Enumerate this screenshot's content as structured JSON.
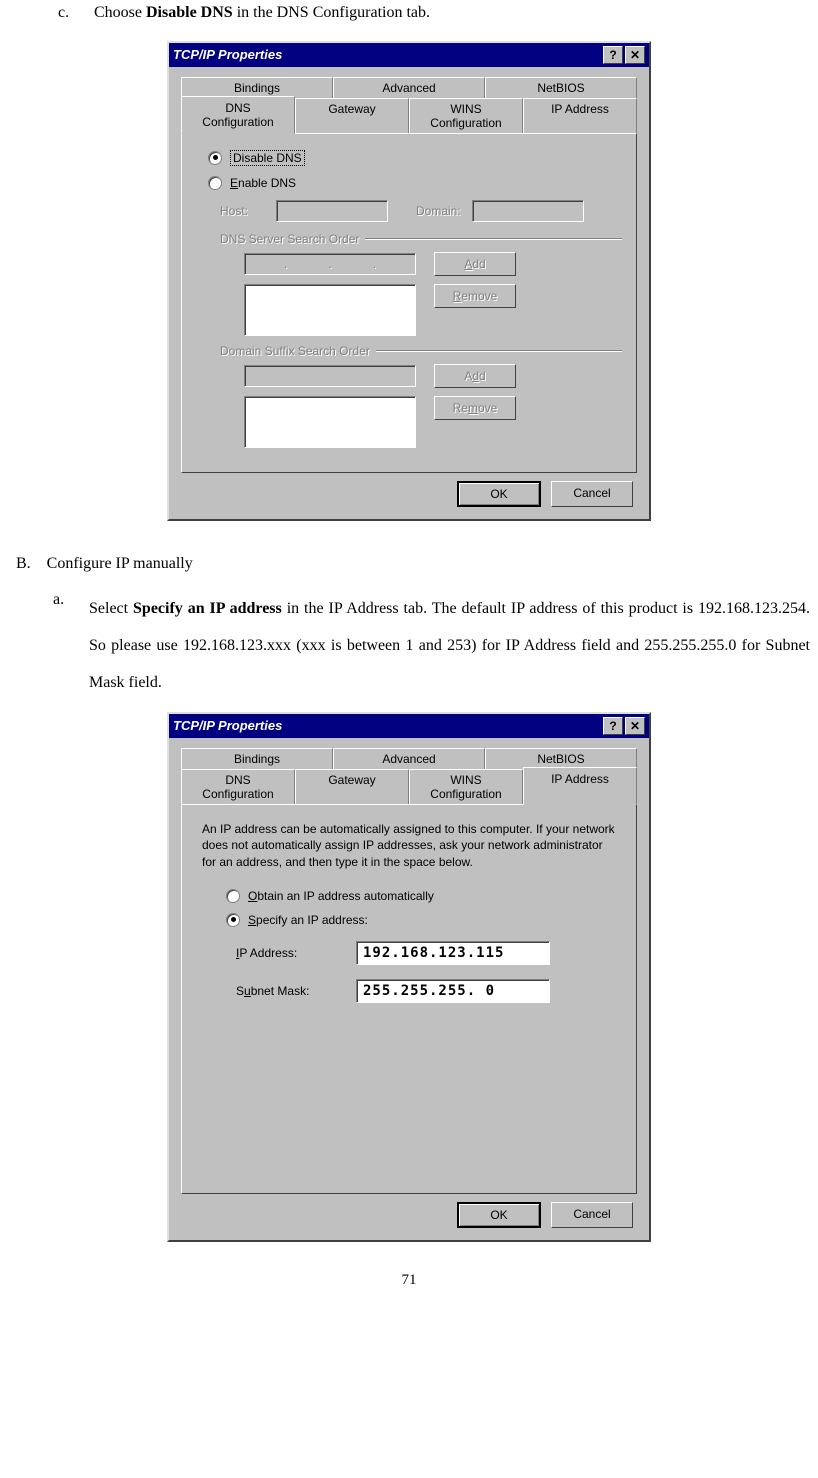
{
  "doc": {
    "step_c_marker": "c.",
    "step_c_prefix": "Choose ",
    "step_c_bold": "Disable DNS",
    "step_c_suffix": " in the DNS Configuration tab.",
    "section_b_marker": "B.",
    "section_b_text": "Configure IP manually",
    "step_a_marker": "a.",
    "step_a_prefix": "Select ",
    "step_a_bold": "Specify an IP address",
    "step_a_suffix": " in the IP Address tab. The default IP address of this product is 192.168.123.254. So please use 192.168.123.xxx (xxx is between 1 and 253) for IP Address field and 255.255.255.0 for Subnet Mask field.",
    "page_number": "71"
  },
  "dialog1": {
    "title": "TCP/IP Properties",
    "help_btn": "?",
    "close_btn": "✕",
    "tabs_row1": [
      "Bindings",
      "Advanced",
      "NetBIOS"
    ],
    "tabs_row2": [
      "DNS Configuration",
      "Gateway",
      "WINS Configuration",
      "IP Address"
    ],
    "radio_disable": "Disable DNS",
    "radio_enable": "Enable DNS",
    "host_label": "Host:",
    "domain_label": "Domain:",
    "dns_order_label": "DNS Server Search Order",
    "domain_suffix_label": "Domain Suffix Search Order",
    "add_btn": "Add",
    "remove_btn": "Remove",
    "ok_btn": "OK",
    "cancel_btn": "Cancel"
  },
  "dialog2": {
    "title": "TCP/IP Properties",
    "help_btn": "?",
    "close_btn": "✕",
    "tabs_row1": [
      "Bindings",
      "Advanced",
      "NetBIOS"
    ],
    "tabs_row2": [
      "DNS Configuration",
      "Gateway",
      "WINS Configuration",
      "IP Address"
    ],
    "description": "An IP address can be automatically assigned to this computer. If your network does not automatically assign IP addresses, ask your network administrator for an address, and then type it in the space below.",
    "radio_obtain_pre": "O",
    "radio_obtain_post": "btain an IP address automatically",
    "radio_specify_pre": "S",
    "radio_specify_post": "pecify an IP address:",
    "ip_label_pre": "I",
    "ip_label_post": "P Address:",
    "subnet_label_pre": "S",
    "subnet_label_mid": "u",
    "subnet_label_post": "bnet Mask:",
    "ip_value": "192.168.123.115",
    "subnet_value": "255.255.255.  0",
    "ok_btn": "OK",
    "cancel_btn": "Cancel"
  }
}
